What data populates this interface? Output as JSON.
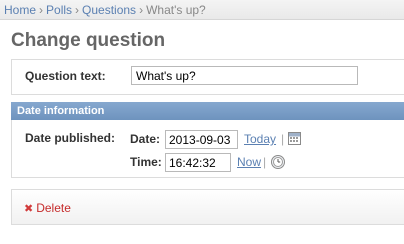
{
  "breadcrumbs": {
    "items": [
      "Home",
      "Polls",
      "Questions"
    ],
    "current": "What's up?",
    "separator": "›"
  },
  "page_title": "Change question",
  "question_field": {
    "label": "Question text:",
    "value": "What's up?"
  },
  "date_section": {
    "heading": "Date information",
    "label": "Date published:",
    "date_label": "Date:",
    "date_value": "2013-09-03",
    "today_link": "Today",
    "time_label": "Time:",
    "time_value": "16:42:32",
    "now_link": "Now",
    "pipe": "|"
  },
  "actions": {
    "delete_label": "Delete",
    "delete_icon": "✖"
  },
  "colors": {
    "link": "#5b80b2",
    "section_header": "#79a0cb",
    "delete": "#c62b2b"
  },
  "icons": {
    "calendar": "calendar-icon",
    "clock": "clock-icon",
    "delete": "delete-x-icon"
  }
}
